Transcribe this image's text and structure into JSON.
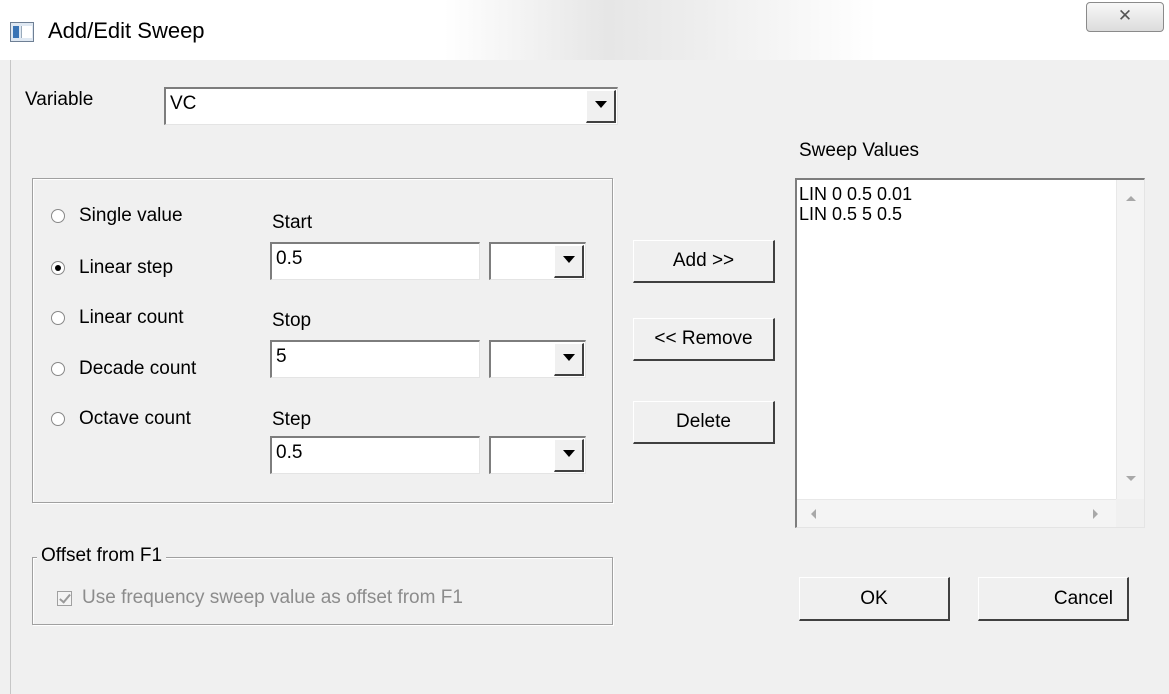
{
  "window": {
    "title": "Add/Edit Sweep",
    "close_glyph": "✕"
  },
  "variable": {
    "label": "Variable",
    "value": "VC"
  },
  "sweep_type": {
    "options": [
      "Single value",
      "Linear step",
      "Linear count",
      "Decade count",
      "Octave count"
    ],
    "selected": "Linear step"
  },
  "fields": {
    "start_label": "Start",
    "start_value": "0.5",
    "start_unit": "",
    "stop_label": "Stop",
    "stop_value": "5",
    "stop_unit": "",
    "step_label": "Step",
    "step_value": "0.5",
    "step_unit": ""
  },
  "buttons": {
    "add": "Add >>",
    "remove": "<< Remove",
    "delete": "Delete",
    "ok": "OK",
    "cancel": "Cancel"
  },
  "sweep_values": {
    "label": "Sweep Values",
    "items": [
      "LIN 0 0.5 0.01",
      "LIN 0.5 5 0.5"
    ]
  },
  "offset": {
    "group_label": "Offset from F1",
    "checkbox_label": "Use frequency sweep value as offset from F1",
    "checked": true,
    "enabled": false
  }
}
